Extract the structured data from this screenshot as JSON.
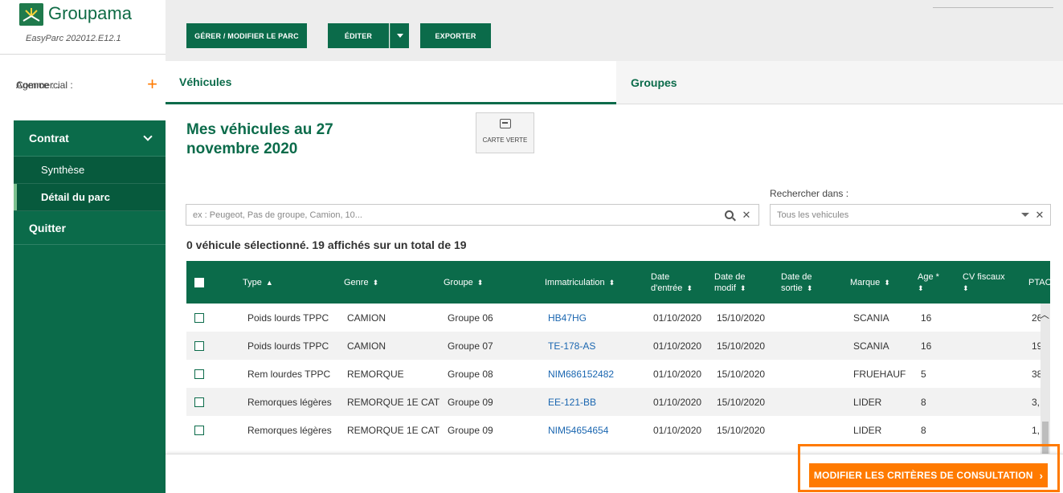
{
  "brand": {
    "name": "Groupama",
    "version": "EasyParc 202012.E12.1"
  },
  "agent": {
    "agence": "Agence : .",
    "commercial": "Commercial :",
    "add_icon": "plus-icon"
  },
  "nav": {
    "contrat": "Contrat",
    "items": [
      {
        "label": "Synthèse"
      },
      {
        "label": "Détail du parc"
      }
    ],
    "quitter": "Quitter"
  },
  "toolbar": {
    "manage": "GÉRER / MODIFIER LE PARC",
    "edit": "ÉDITER",
    "export": "EXPORTER"
  },
  "tabs": {
    "vehicles": "Véhicules",
    "groups": "Groupes"
  },
  "page": {
    "title": "Mes véhicules au 27 novembre 2020",
    "carte_verte": "CARTE VERTE",
    "search_placeholder": "ex : Peugeot, Pas de groupe, Camion, 10...",
    "search_in_label": "Rechercher dans :",
    "search_in_value": "Tous les vehicules",
    "count": "0 véhicule sélectionné. 19 affichés sur un total de 19"
  },
  "table": {
    "headers": {
      "type": "Type",
      "genre": "Genre",
      "groupe": "Groupe",
      "immat": "Immatriculation",
      "entree_1": "Date",
      "entree_2": "d'entrée",
      "modif_1": "Date de",
      "modif_2": "modif",
      "sortie_1": "Date de",
      "sortie_2": "sortie",
      "marque": "Marque",
      "age": "Age *",
      "cv": "CV fiscaux",
      "ptac": "PTAC"
    },
    "rows": [
      {
        "type": "Poids lourds TPPC",
        "genre": "CAMION",
        "groupe": "Groupe 06",
        "immat": "HB47HG",
        "entree": "01/10/2020",
        "modif": "15/10/2020",
        "sortie": "",
        "marque": "SCANIA",
        "age": "16",
        "cv": "",
        "ptac": "26"
      },
      {
        "type": "Poids lourds TPPC",
        "genre": "CAMION",
        "groupe": "Groupe 07",
        "immat": "TE-178-AS",
        "entree": "01/10/2020",
        "modif": "15/10/2020",
        "sortie": "",
        "marque": "SCANIA",
        "age": "16",
        "cv": "",
        "ptac": "19"
      },
      {
        "type": "Rem lourdes TPPC",
        "genre": "REMORQUE",
        "groupe": "Groupe 08",
        "immat": "NIM686152482",
        "entree": "01/10/2020",
        "modif": "15/10/2020",
        "sortie": "",
        "marque": "FRUEHAUF",
        "age": "5",
        "cv": "",
        "ptac": "38"
      },
      {
        "type": "Remorques légères",
        "genre": "REMORQUE 1E CAT",
        "groupe": "Groupe 09",
        "immat": "EE-121-BB",
        "entree": "01/10/2020",
        "modif": "15/10/2020",
        "sortie": "",
        "marque": "LIDER",
        "age": "8",
        "cv": "",
        "ptac": "3,"
      },
      {
        "type": "Remorques légères",
        "genre": "REMORQUE 1E CAT",
        "groupe": "Groupe 09",
        "immat": "NIM54654654",
        "entree": "01/10/2020",
        "modif": "15/10/2020",
        "sortie": "",
        "marque": "LIDER",
        "age": "8",
        "cv": "",
        "ptac": "1,"
      }
    ]
  },
  "footer": {
    "cta": "MODIFIER LES CRITÈRES DE CONSULTATION"
  },
  "colors": {
    "brand_green": "#0b6b4a",
    "accent_orange": "#ff7a00",
    "link_blue": "#1a66b0"
  }
}
